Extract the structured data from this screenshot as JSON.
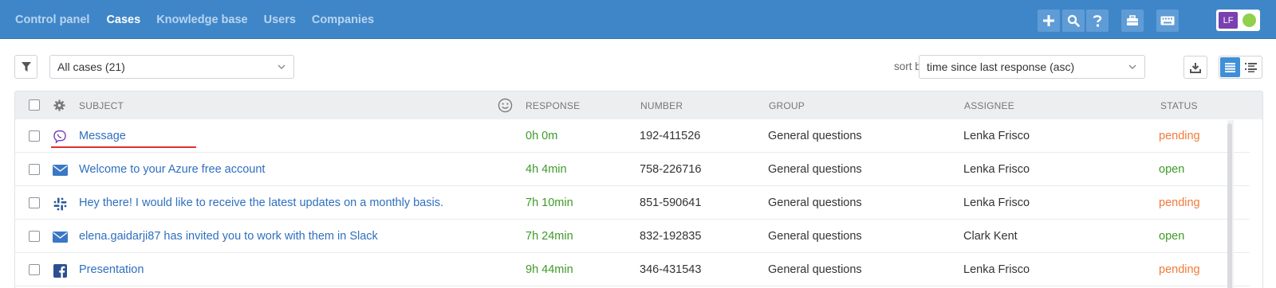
{
  "nav": {
    "items": [
      {
        "label": "Control panel",
        "active": false
      },
      {
        "label": "Cases",
        "active": true
      },
      {
        "label": "Knowledge base",
        "active": false
      },
      {
        "label": "Users",
        "active": false
      },
      {
        "label": "Companies",
        "active": false
      }
    ],
    "actions": [
      "plus-icon",
      "search-icon",
      "help-icon",
      "briefcase-icon",
      "keyboard-icon"
    ],
    "user": {
      "initials": "LF",
      "status_color": "#8fd14a",
      "avatar_color": "#7a3fb0"
    }
  },
  "toolbar": {
    "filter_select": "All cases (21)",
    "sort_label": "sort by:",
    "sort_select": "time since last response (asc)"
  },
  "table": {
    "columns": {
      "subject": "SUBJECT",
      "response": "RESPONSE",
      "number": "NUMBER",
      "group": "GROUP",
      "assignee": "ASSIGNEE",
      "status": "STATUS"
    },
    "rows": [
      {
        "channel": "viber-icon",
        "subject": "Message",
        "response": "0h 0m",
        "number": "192-411526",
        "group": "General questions",
        "assignee": "Lenka Frisco",
        "status": "pending"
      },
      {
        "channel": "email-icon",
        "subject": "Welcome to your Azure free account",
        "response": "4h 4min",
        "number": "758-226716",
        "group": "General questions",
        "assignee": "Lenka Frisco",
        "status": "open"
      },
      {
        "channel": "slack-icon",
        "subject": "Hey there! I would like to receive the latest updates on a monthly basis.",
        "response": "7h 10min",
        "number": "851-590641",
        "group": "General questions",
        "assignee": "Lenka Frisco",
        "status": "pending"
      },
      {
        "channel": "email-icon",
        "subject": "elena.gaidarji87 has invited you to work with them in Slack",
        "response": "7h 24min",
        "number": "832-192835",
        "group": "General questions",
        "assignee": "Clark Kent",
        "status": "open"
      },
      {
        "channel": "facebook-icon",
        "subject": "Presentation",
        "response": "9h 44min",
        "number": "346-431543",
        "group": "General questions",
        "assignee": "Lenka Frisco",
        "status": "pending"
      }
    ]
  },
  "colors": {
    "header_bg": "#3f86c9",
    "link": "#2f6fc0",
    "open": "#3d9a27",
    "pending": "#f07a3a",
    "annotation": "#e03030"
  }
}
